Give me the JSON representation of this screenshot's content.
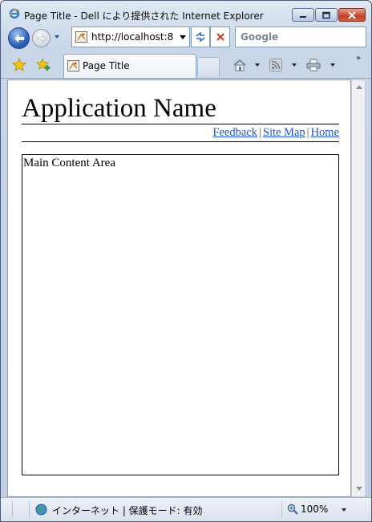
{
  "window": {
    "title": "Page Title - Dell により提供された Internet Explorer"
  },
  "address_bar": {
    "url": "http://localhost:8"
  },
  "search": {
    "placeholder": "Google"
  },
  "tab": {
    "title": "Page Title"
  },
  "page": {
    "app_name": "Application Name",
    "nav_links": [
      "Feedback",
      "Site Map",
      "Home"
    ],
    "separator": "|",
    "main_content": "Main Content Area"
  },
  "status_bar": {
    "zone": "インターネット | 保護モード: 有効",
    "zoom": "100%"
  },
  "colors": {
    "link": "#1f55d0",
    "close_button": "#c2422a"
  },
  "icons": [
    "ie-logo-icon",
    "minimize-icon",
    "maximize-icon",
    "close-icon",
    "back-arrow-icon",
    "forward-arrow-icon",
    "page-icon",
    "refresh-icon",
    "stop-icon",
    "favorites-star-icon",
    "add-favorite-icon",
    "home-icon",
    "rss-feed-icon",
    "print-icon",
    "globe-icon",
    "zoom-icon"
  ]
}
